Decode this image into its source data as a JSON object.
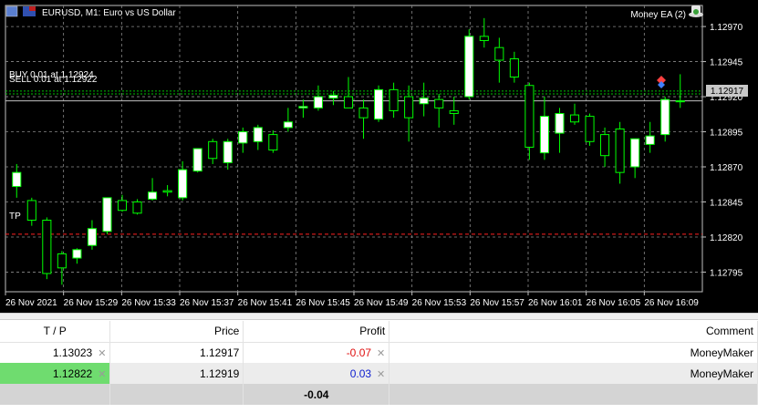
{
  "chart": {
    "title": "EURUSD, M1:  Euro vs US Dollar",
    "ea_label": "Money EA (2)",
    "buy_label": "BUY 0.01 at 1.12924",
    "sell_label": "SELL 0.01 at 1.12922",
    "tp_label": "TP",
    "current_price_label": "1.12917",
    "price_ticks": [
      "1.12970",
      "1.12945",
      "1.12920",
      "1.12895",
      "1.12870",
      "1.12845",
      "1.12820",
      "1.12795"
    ],
    "time_ticks": [
      "26 Nov 2021",
      "26 Nov 15:29",
      "26 Nov 15:33",
      "26 Nov 15:37",
      "26 Nov 15:41",
      "26 Nov 15:45",
      "26 Nov 15:49",
      "26 Nov 15:53",
      "26 Nov 15:57",
      "26 Nov 16:01",
      "26 Nov 16:05",
      "26 Nov 16:09"
    ],
    "colors": {
      "background": "#000000",
      "grid": "#8a8a8a",
      "bull": "#ffffff",
      "bear": "#000000",
      "wick": "#00ff00",
      "trade_line": "#00c000",
      "tp_line": "#ff2020",
      "price_line": "#c0c0c0"
    }
  },
  "chart_data": {
    "type": "candlestick",
    "symbol": "EURUSD",
    "timeframe": "M1",
    "ylim": [
      1.12781,
      1.12985
    ],
    "buy_price": 1.12924,
    "sell_price": 1.12922,
    "take_profit": 1.12822,
    "current_price": 1.12917,
    "candles": [
      {
        "o": 1.12856,
        "h": 1.12872,
        "l": 1.12848,
        "c": 1.12866
      },
      {
        "o": 1.12846,
        "h": 1.12848,
        "l": 1.12828,
        "c": 1.12832
      },
      {
        "o": 1.12832,
        "h": 1.12834,
        "l": 1.1279,
        "c": 1.12794
      },
      {
        "o": 1.12808,
        "h": 1.1281,
        "l": 1.12786,
        "c": 1.12798
      },
      {
        "o": 1.12805,
        "h": 1.12812,
        "l": 1.12801,
        "c": 1.12811
      },
      {
        "o": 1.12814,
        "h": 1.12832,
        "l": 1.12811,
        "c": 1.12826
      },
      {
        "o": 1.12824,
        "h": 1.12848,
        "l": 1.12822,
        "c": 1.12848
      },
      {
        "o": 1.12846,
        "h": 1.1285,
        "l": 1.12838,
        "c": 1.12839
      },
      {
        "o": 1.12845,
        "h": 1.12847,
        "l": 1.12836,
        "c": 1.12837
      },
      {
        "o": 1.12847,
        "h": 1.12862,
        "l": 1.12846,
        "c": 1.12852
      },
      {
        "o": 1.12853,
        "h": 1.12857,
        "l": 1.12849,
        "c": 1.12852
      },
      {
        "o": 1.12848,
        "h": 1.12874,
        "l": 1.12846,
        "c": 1.12868
      },
      {
        "o": 1.12867,
        "h": 1.1288,
        "l": 1.12866,
        "c": 1.12883
      },
      {
        "o": 1.12888,
        "h": 1.1289,
        "l": 1.12872,
        "c": 1.12876
      },
      {
        "o": 1.12873,
        "h": 1.1289,
        "l": 1.12868,
        "c": 1.12888
      },
      {
        "o": 1.12887,
        "h": 1.12898,
        "l": 1.1288,
        "c": 1.12895
      },
      {
        "o": 1.12888,
        "h": 1.129,
        "l": 1.12882,
        "c": 1.12898
      },
      {
        "o": 1.12893,
        "h": 1.12896,
        "l": 1.1288,
        "c": 1.12882
      },
      {
        "o": 1.12898,
        "h": 1.12912,
        "l": 1.12895,
        "c": 1.12902
      },
      {
        "o": 1.12912,
        "h": 1.12918,
        "l": 1.12905,
        "c": 1.12913
      },
      {
        "o": 1.12912,
        "h": 1.12928,
        "l": 1.1291,
        "c": 1.1292
      },
      {
        "o": 1.12919,
        "h": 1.12924,
        "l": 1.12914,
        "c": 1.12921
      },
      {
        "o": 1.1292,
        "h": 1.12934,
        "l": 1.12912,
        "c": 1.12912
      },
      {
        "o": 1.12912,
        "h": 1.12918,
        "l": 1.1289,
        "c": 1.12905
      },
      {
        "o": 1.12904,
        "h": 1.12928,
        "l": 1.12902,
        "c": 1.12925
      },
      {
        "o": 1.12925,
        "h": 1.1293,
        "l": 1.12905,
        "c": 1.1291
      },
      {
        "o": 1.1292,
        "h": 1.12928,
        "l": 1.12888,
        "c": 1.12905
      },
      {
        "o": 1.12915,
        "h": 1.1293,
        "l": 1.12906,
        "c": 1.12919
      },
      {
        "o": 1.12918,
        "h": 1.12922,
        "l": 1.12898,
        "c": 1.12912
      },
      {
        "o": 1.1291,
        "h": 1.1292,
        "l": 1.129,
        "c": 1.12908
      },
      {
        "o": 1.1292,
        "h": 1.12968,
        "l": 1.12918,
        "c": 1.12963
      },
      {
        "o": 1.12963,
        "h": 1.12976,
        "l": 1.12955,
        "c": 1.1296
      },
      {
        "o": 1.12955,
        "h": 1.12962,
        "l": 1.1293,
        "c": 1.12946
      },
      {
        "o": 1.12947,
        "h": 1.12952,
        "l": 1.1293,
        "c": 1.12934
      },
      {
        "o": 1.12928,
        "h": 1.1293,
        "l": 1.12875,
        "c": 1.12884
      },
      {
        "o": 1.1288,
        "h": 1.1292,
        "l": 1.12875,
        "c": 1.12906
      },
      {
        "o": 1.12894,
        "h": 1.12912,
        "l": 1.1288,
        "c": 1.12908
      },
      {
        "o": 1.12907,
        "h": 1.12915,
        "l": 1.129,
        "c": 1.12902
      },
      {
        "o": 1.12906,
        "h": 1.12908,
        "l": 1.12885,
        "c": 1.12888
      },
      {
        "o": 1.12893,
        "h": 1.12898,
        "l": 1.1287,
        "c": 1.12878
      },
      {
        "o": 1.12897,
        "h": 1.12902,
        "l": 1.12858,
        "c": 1.12866
      },
      {
        "o": 1.1287,
        "h": 1.1289,
        "l": 1.12862,
        "c": 1.1289
      },
      {
        "o": 1.12886,
        "h": 1.12902,
        "l": 1.1288,
        "c": 1.12892
      },
      {
        "o": 1.12893,
        "h": 1.1292,
        "l": 1.12888,
        "c": 1.12918
      },
      {
        "o": 1.12917,
        "h": 1.12936,
        "l": 1.12912,
        "c": 1.12917
      }
    ]
  },
  "table": {
    "headers": {
      "tp": "T / P",
      "price": "Price",
      "profit": "Profit",
      "comment": "Comment"
    },
    "rows": [
      {
        "tp": "1.13023",
        "price": "1.12917",
        "profit": "-0.07",
        "comment": "MoneyMaker"
      },
      {
        "tp": "1.12822",
        "price": "1.12919",
        "profit": "0.03",
        "comment": "MoneyMaker"
      }
    ],
    "close_glyph": "✕",
    "total_profit": "-0.04"
  }
}
